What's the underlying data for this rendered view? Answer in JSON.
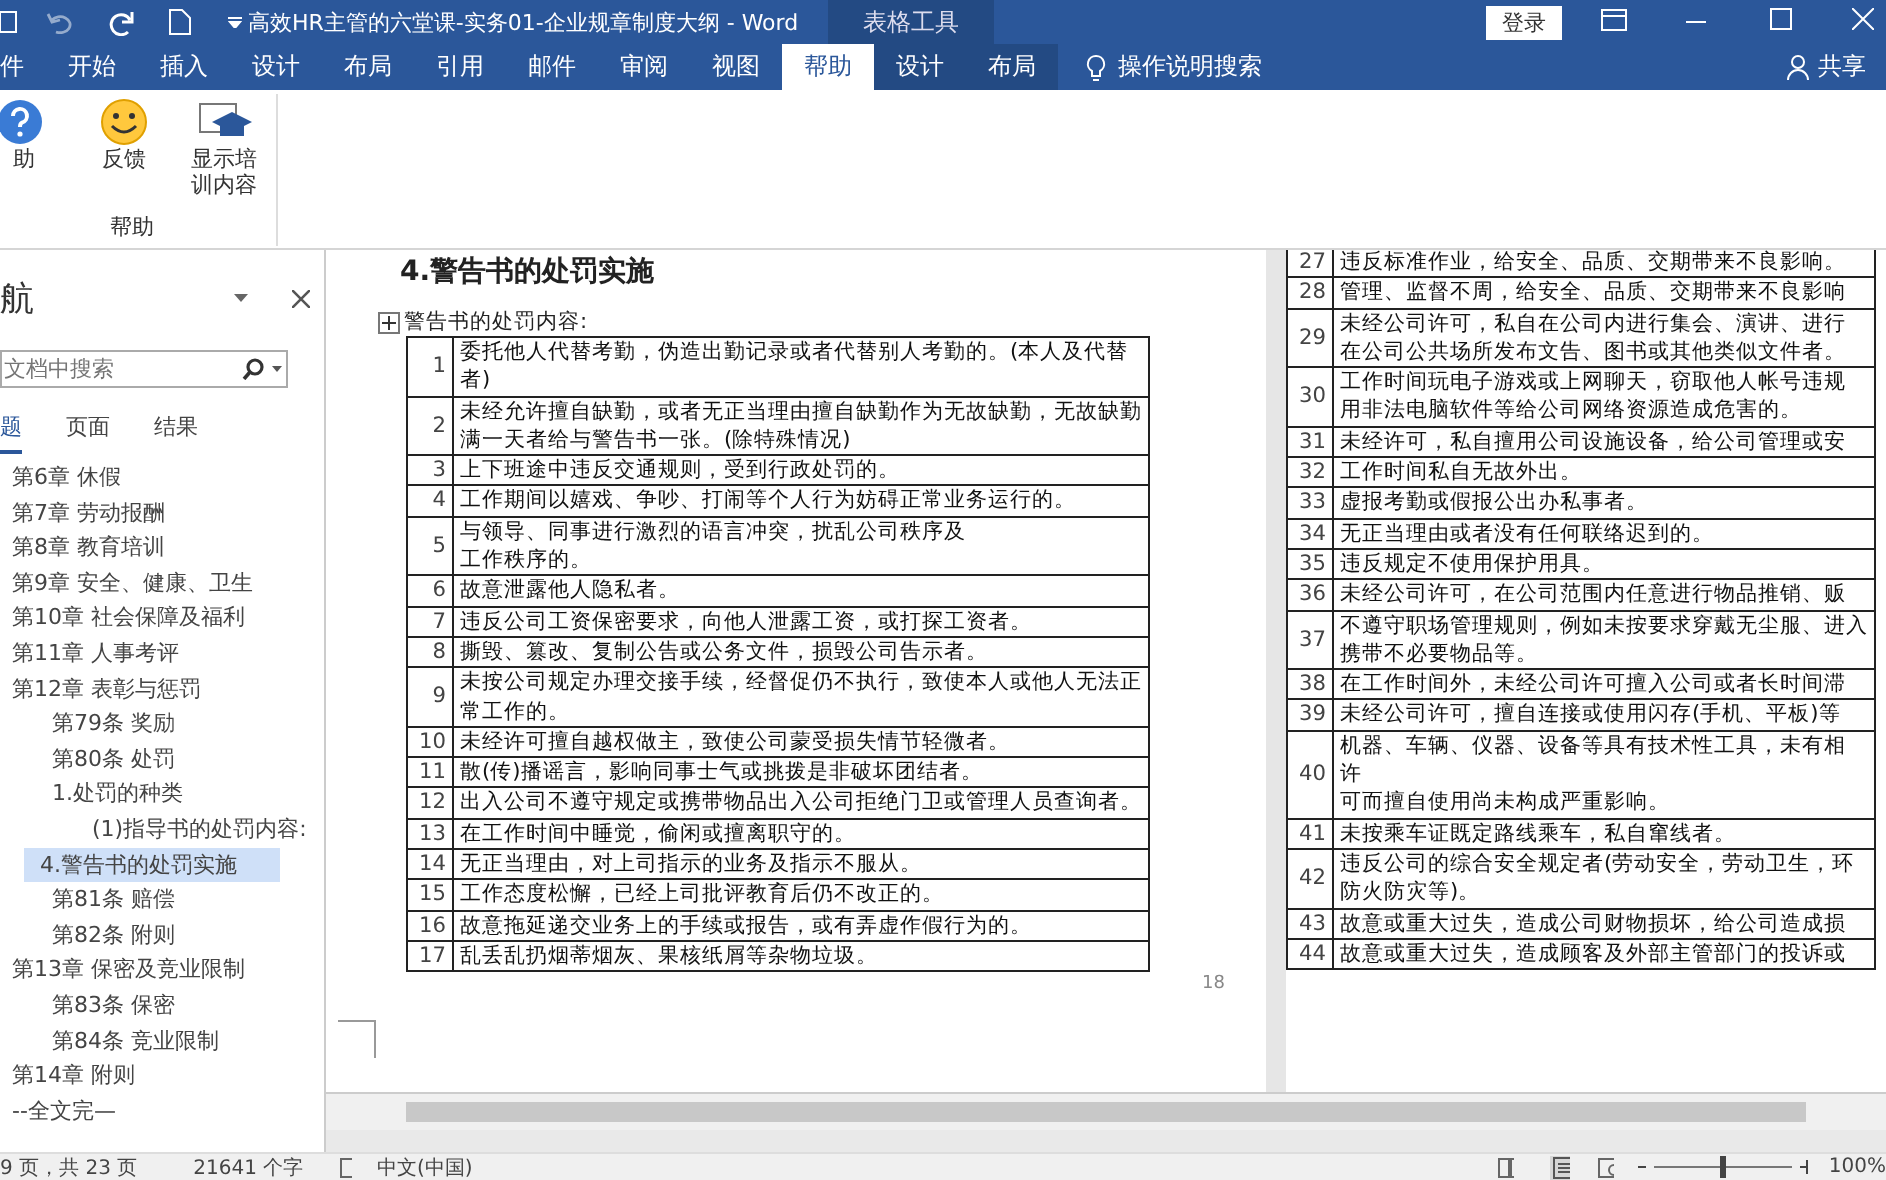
{
  "window": {
    "title": "高效HR主管的六堂课-实务01-企业规章制度大纲 - Word",
    "context_tab_group": "表格工具",
    "sign_in": "登录"
  },
  "ribbon_tabs": [
    {
      "label": "件",
      "selected": false
    },
    {
      "label": "开始",
      "selected": false
    },
    {
      "label": "插入",
      "selected": false
    },
    {
      "label": "设计",
      "selected": false
    },
    {
      "label": "布局",
      "selected": false
    },
    {
      "label": "引用",
      "selected": false
    },
    {
      "label": "邮件",
      "selected": false
    },
    {
      "label": "审阅",
      "selected": false
    },
    {
      "label": "视图",
      "selected": false
    },
    {
      "label": "帮助",
      "selected": true
    },
    {
      "label": "设计",
      "selected": false
    },
    {
      "label": "布局",
      "selected": false
    }
  ],
  "tell_me": "操作说明搜索",
  "share": "共享",
  "ribbon": {
    "buttons": [
      {
        "kind": "help",
        "label": "助"
      },
      {
        "kind": "feedback",
        "label": "反馈"
      },
      {
        "kind": "training",
        "label": "显示培训内容"
      }
    ],
    "group_label": "帮助"
  },
  "nav": {
    "title": "航",
    "search": {
      "placeholder": "文档中搜索"
    },
    "tabs": [
      {
        "label": "题",
        "selected": true
      },
      {
        "label": "页面",
        "selected": false
      },
      {
        "label": "结果",
        "selected": false
      }
    ],
    "tree": [
      {
        "label": "第6章  休假",
        "selected": false
      },
      {
        "label": "第7章  劳动报酬",
        "selected": false
      },
      {
        "label": "第8章  教育培训",
        "selected": false
      },
      {
        "label": "第9章  安全、健康、卫生",
        "selected": false
      },
      {
        "label": "第10章  社会保障及福利",
        "selected": false
      },
      {
        "label": "第11章  人事考评",
        "selected": false
      },
      {
        "label": "第12章  表彰与惩罚",
        "selected": false,
        "children": [
          {
            "label": "第79条  奖励",
            "selected": false
          },
          {
            "label": "第80条  处罚",
            "selected": false
          },
          {
            "label": "1.处罚的种类",
            "selected": false,
            "children": [
              {
                "label": "(1)指导书的处罚内容:",
                "selected": false
              }
            ]
          },
          {
            "label": "4.警告书的处罚实施",
            "selected": true
          },
          {
            "label": "第81条  赔偿",
            "selected": false
          },
          {
            "label": "第82条  附则",
            "selected": false
          }
        ]
      },
      {
        "label": "第13章  保密及竞业限制",
        "selected": false,
        "children": [
          {
            "label": "第83条  保密",
            "selected": false
          },
          {
            "label": "第84条  竞业限制",
            "selected": false
          }
        ]
      },
      {
        "label": "第14章  附则",
        "selected": false
      },
      {
        "label": "--全文完—",
        "selected": false
      }
    ]
  },
  "left_page": {
    "heading": "4.警告书的处罚实施",
    "caption": "警告书的处罚内容:",
    "page_number": "18",
    "rows": [
      {
        "number": "1",
        "lines": [
          "委托他人代替考勤，伪造出勤记录或者代替别人考勤的。(本人及代替",
          "者)"
        ]
      },
      {
        "number": "2",
        "lines": [
          "未经允许擅自缺勤，或者无正当理由擅自缺勤作为无故缺勤，无故缺勤",
          "满一天者给与警告书一张。(除特殊情况)"
        ]
      },
      {
        "number": "3",
        "lines": [
          "上下班途中违反交通规则，受到行政处罚的。"
        ]
      },
      {
        "number": "4",
        "lines": [
          "工作期间以嬉戏、争吵、打闹等个人行为妨碍正常业务运行的。"
        ]
      },
      {
        "number": "5",
        "lines": [
          "与领导、同事进行激烈的语言冲突，扰乱公司秩序及",
          "工作秩序的。"
        ]
      },
      {
        "number": "6",
        "lines": [
          "故意泄露他人隐私者。"
        ]
      },
      {
        "number": "7",
        "lines": [
          "违反公司工资保密要求，向他人泄露工资，或打探工资者。"
        ]
      },
      {
        "number": "8",
        "lines": [
          "撕毁、篡改、复制公告或公务文件，损毁公司告示者。"
        ]
      },
      {
        "number": "9",
        "lines": [
          "未按公司规定办理交接手续，经督促仍不执行，致使本人或他人无法正",
          "常工作的。"
        ]
      },
      {
        "number": "10",
        "lines": [
          "未经许可擅自越权做主，致使公司蒙受损失情节轻微者。"
        ]
      },
      {
        "number": "11",
        "lines": [
          "散(传)播谣言，影响同事士气或挑拨是非破坏团结者。"
        ]
      },
      {
        "number": "12",
        "lines": [
          "出入公司不遵守规定或携带物品出入公司拒绝门卫或管理人员查询者。"
        ]
      },
      {
        "number": "13",
        "lines": [
          "在工作时间中睡觉，偷闲或擅离职守的。"
        ]
      },
      {
        "number": "14",
        "lines": [
          "无正当理由，对上司指示的业务及指示不服从。"
        ]
      },
      {
        "number": "15",
        "lines": [
          "工作态度松懈，已经上司批评教育后仍不改正的。"
        ]
      },
      {
        "number": "16",
        "lines": [
          "故意拖延递交业务上的手续或报告，或有弄虚作假行为的。"
        ]
      },
      {
        "number": "17",
        "lines": [
          "乱丢乱扔烟蒂烟灰、果核纸屑等杂物垃圾。"
        ]
      }
    ]
  },
  "right_page": {
    "rows": [
      {
        "number": "27",
        "lines": [
          "违反标准作业，给安全、品质、交期带来不良影响。"
        ]
      },
      {
        "number": "28",
        "lines": [
          "管理、监督不周，给安全、品质、交期带来不良影响"
        ]
      },
      {
        "number": "29",
        "lines": [
          "未经公司许可，私自在公司内进行集会、演讲、进行",
          "在公司公共场所发布文告、图书或其他类似文件者。"
        ]
      },
      {
        "number": "30",
        "lines": [
          "工作时间玩电子游戏或上网聊天，窃取他人帐号违规",
          "用非法电脑软件等给公司网络资源造成危害的。"
        ]
      },
      {
        "number": "31",
        "lines": [
          "未经许可，私自擅用公司设施设备，给公司管理或安"
        ]
      },
      {
        "number": "32",
        "lines": [
          "工作时间私自无故外出。"
        ]
      },
      {
        "number": "33",
        "lines": [
          "虚报考勤或假报公出办私事者。"
        ]
      },
      {
        "number": "34",
        "lines": [
          "无正当理由或者没有任何联络迟到的。"
        ]
      },
      {
        "number": "35",
        "lines": [
          "违反规定不使用保护用具。"
        ]
      },
      {
        "number": "36",
        "lines": [
          "未经公司许可，在公司范围内任意进行物品推销、贩"
        ]
      },
      {
        "number": "37",
        "lines": [
          "不遵守职场管理规则，例如未按要求穿戴无尘服、进入",
          "携带不必要物品等。"
        ]
      },
      {
        "number": "38",
        "lines": [
          "在工作时间外，未经公司许可擅入公司或者长时间滞"
        ]
      },
      {
        "number": "39",
        "lines": [
          "未经公司许可，擅自连接或使用闪存(手机、平板)等"
        ]
      },
      {
        "number": "40",
        "lines": [
          "机器、车辆、仪器、设备等具有技术性工具，未有相",
          "许",
          "可而擅自使用尚未构成严重影响。"
        ]
      },
      {
        "number": "41",
        "lines": [
          "未按乘车证既定路线乘车，私自窜线者。"
        ]
      },
      {
        "number": "42",
        "lines": [
          "违反公司的综合安全规定者(劳动安全，劳动卫生，环",
          "防火防灾等)。"
        ]
      },
      {
        "number": "43",
        "lines": [
          "故意或重大过失，造成公司财物损坏，给公司造成损"
        ]
      },
      {
        "number": "44",
        "lines": [
          "故意或重大过失，造成顾客及外部主管部门的投诉或"
        ]
      }
    ]
  },
  "status_bar": {
    "page": "9 页，共 23 页",
    "words": "21641 个字",
    "language": "中文(中国)",
    "zoom": "100%",
    "zoom_level": {
      "level": 0.5
    }
  }
}
